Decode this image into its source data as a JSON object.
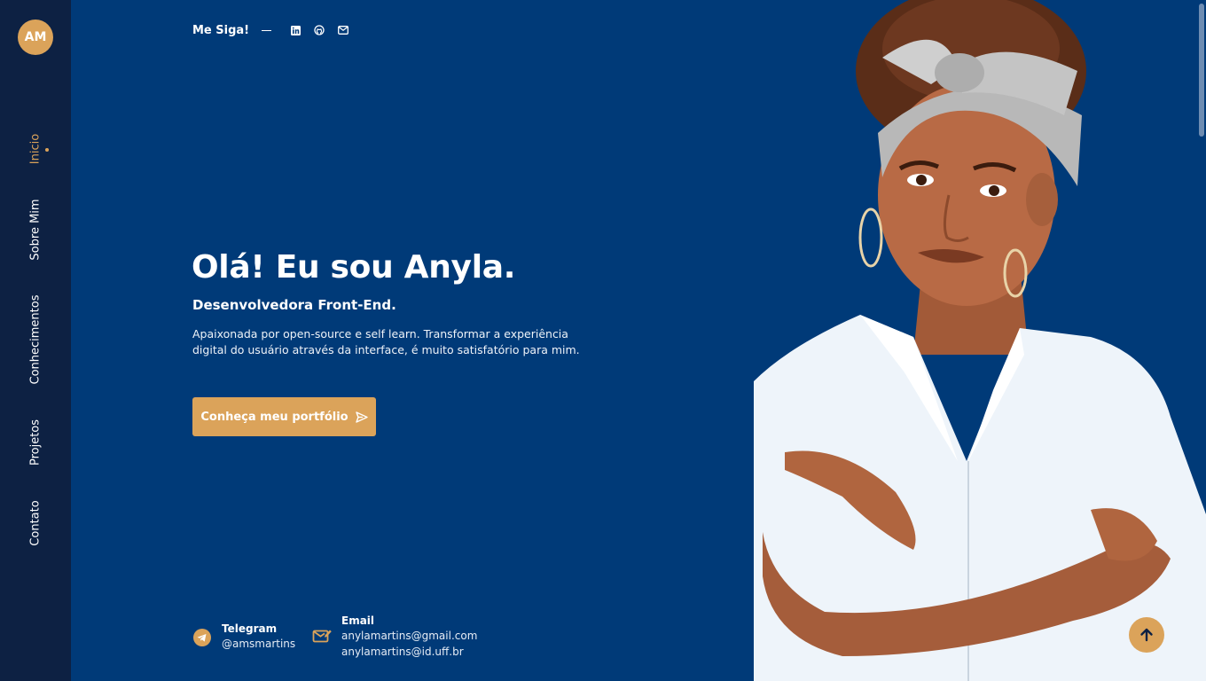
{
  "logo": {
    "initials": "AM"
  },
  "nav": {
    "items": [
      {
        "label": "Inicio",
        "active": true
      },
      {
        "label": "Sobre Mim",
        "active": false
      },
      {
        "label": "Conhecimentos",
        "active": false
      },
      {
        "label": "Projetos",
        "active": false
      },
      {
        "label": "Contato",
        "active": false
      }
    ]
  },
  "follow": {
    "label": "Me Siga!",
    "icons": [
      "linkedin-icon",
      "github-icon",
      "mail-icon"
    ]
  },
  "hero": {
    "title": "Olá! Eu sou Anyla.",
    "subtitle": "Desenvolvedora Front-End.",
    "description": "Apaixonada por open-source e self learn. Transformar a experiência digital do usuário através da interface, é muito satisfatório para mim.",
    "cta_label": "Conheça meu portfólio"
  },
  "contacts": {
    "telegram": {
      "title": "Telegram",
      "handle": "@amsmartins"
    },
    "email": {
      "title": "Email",
      "primary": "anylamartins@gmail.com",
      "secondary": "anylamartins@id.uff.br"
    }
  },
  "colors": {
    "background": "#003a78",
    "sidebar": "#0d2143",
    "accent": "#dba35a"
  }
}
